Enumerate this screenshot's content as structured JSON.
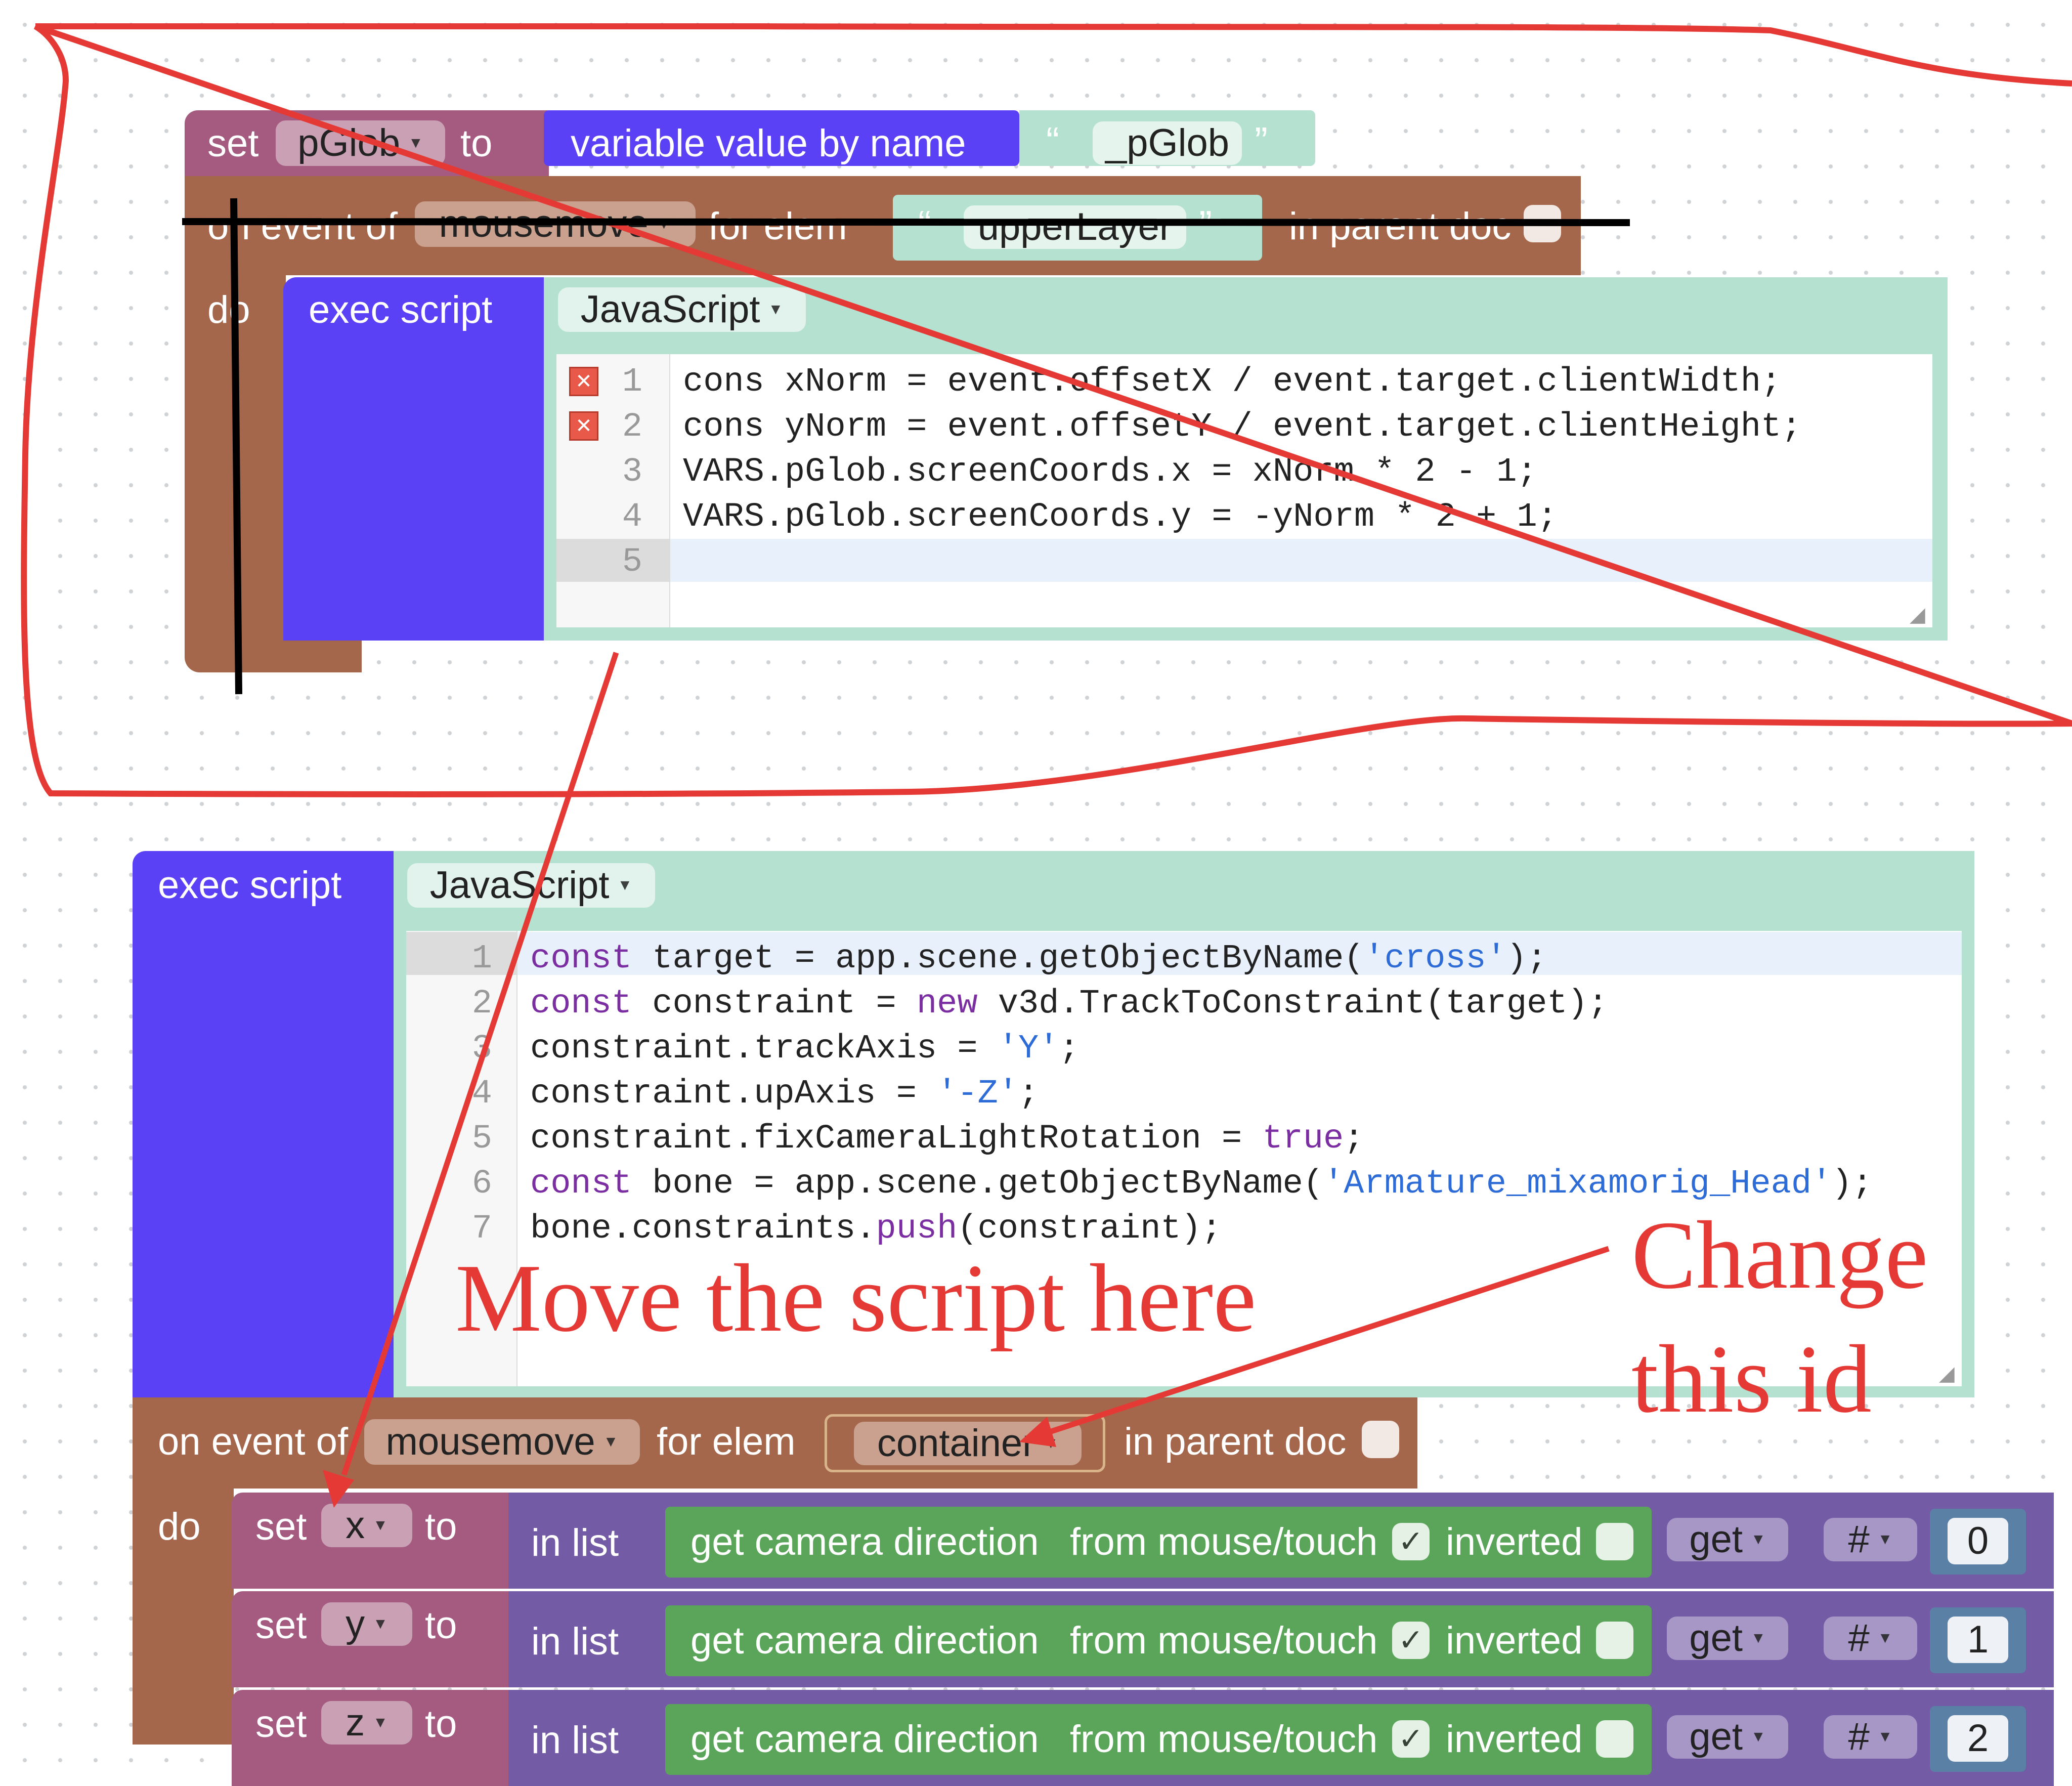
{
  "block1": {
    "set_label": "set",
    "set_var": "pGlob",
    "to_label": "to",
    "varvalue_label": "variable value by name",
    "varvalue_arg": "_pGlob",
    "event_on_label": "on event of",
    "event_name": "mousemove",
    "for_elem_label": "for elem",
    "elem_id": "upperLayer",
    "parent_doc_label": "in parent doc",
    "do_label": "do",
    "exec_label": "exec script",
    "lang": "JavaScript",
    "line_numbers": [
      "1",
      "2",
      "3",
      "4",
      "5"
    ],
    "code_lines": [
      "cons xNorm = event.offsetX / event.target.clientWidth;",
      "cons yNorm = event.offsetY / event.target.clientHeight;",
      "VARS.pGlob.screenCoords.x = xNorm * 2 - 1;",
      "VARS.pGlob.screenCoords.y = -yNorm * 2 + 1;",
      ""
    ],
    "error_lines": [
      1,
      2
    ]
  },
  "block2": {
    "exec_label": "exec script",
    "lang": "JavaScript",
    "line_numbers": [
      "1",
      "2",
      "3",
      "4",
      "5",
      "6",
      "7"
    ],
    "code": [
      [
        [
          "kw",
          "const"
        ],
        [
          "",
          " target = app.scene.getObjectByName("
        ],
        [
          "str",
          "'cross'"
        ],
        [
          "",
          ");"
        ]
      ],
      [
        [
          "kw",
          "const"
        ],
        [
          "",
          " constraint = "
        ],
        [
          "kw",
          "new"
        ],
        [
          "",
          " v3d.TrackToConstraint(target);"
        ]
      ],
      [
        [
          "",
          "constraint.trackAxis = "
        ],
        [
          "str",
          "'Y'"
        ],
        [
          "",
          ";"
        ]
      ],
      [
        [
          "",
          "constraint.upAxis = "
        ],
        [
          "str",
          "'-Z'"
        ],
        [
          "",
          ";"
        ]
      ],
      [
        [
          "",
          "constraint.fixCameraLightRotation = "
        ],
        [
          "kw",
          "true"
        ],
        [
          "",
          ";"
        ]
      ],
      [
        [
          "kw",
          "const"
        ],
        [
          "",
          " bone = app.scene.getObjectByName("
        ],
        [
          "str",
          "'Armature_mixamorig_Head'"
        ],
        [
          "",
          ");"
        ]
      ],
      [
        [
          "",
          "bone.constraints."
        ],
        [
          "kw",
          "push"
        ],
        [
          "",
          "(constraint);"
        ]
      ]
    ]
  },
  "block3": {
    "event_on_label": "on event of",
    "event_name": "mousemove",
    "for_elem_label": "for elem",
    "elem_id": "container",
    "parent_doc_label": "in parent doc",
    "do_label": "do",
    "rows": [
      {
        "set_label": "set",
        "var": "x",
        "to_label": "to",
        "inlist": "in list",
        "camera": "get camera direction",
        "from": "from mouse/touch",
        "inverted": "inverted",
        "get": "get",
        "hash": "#",
        "index": "0"
      },
      {
        "set_label": "set",
        "var": "y",
        "to_label": "to",
        "inlist": "in list",
        "camera": "get camera direction",
        "from": "from mouse/touch",
        "inverted": "inverted",
        "get": "get",
        "hash": "#",
        "index": "1"
      },
      {
        "set_label": "set",
        "var": "z",
        "to_label": "to",
        "inlist": "in list",
        "camera": "get camera direction",
        "from": "from mouse/touch",
        "inverted": "inverted",
        "get": "get",
        "hash": "#",
        "index": "2"
      }
    ]
  },
  "annotations": {
    "move_text": "Move the script here",
    "change_line1": "Change",
    "change_line2": "this id"
  },
  "colors": {
    "set_block": "#a55b80",
    "event_block": "#a5674c",
    "exec_block": "#5b41f5",
    "script_field": "#b5e1d1",
    "list_block": "#745ba5",
    "camera_block": "#5ba55b",
    "annotation": "#e53935"
  }
}
